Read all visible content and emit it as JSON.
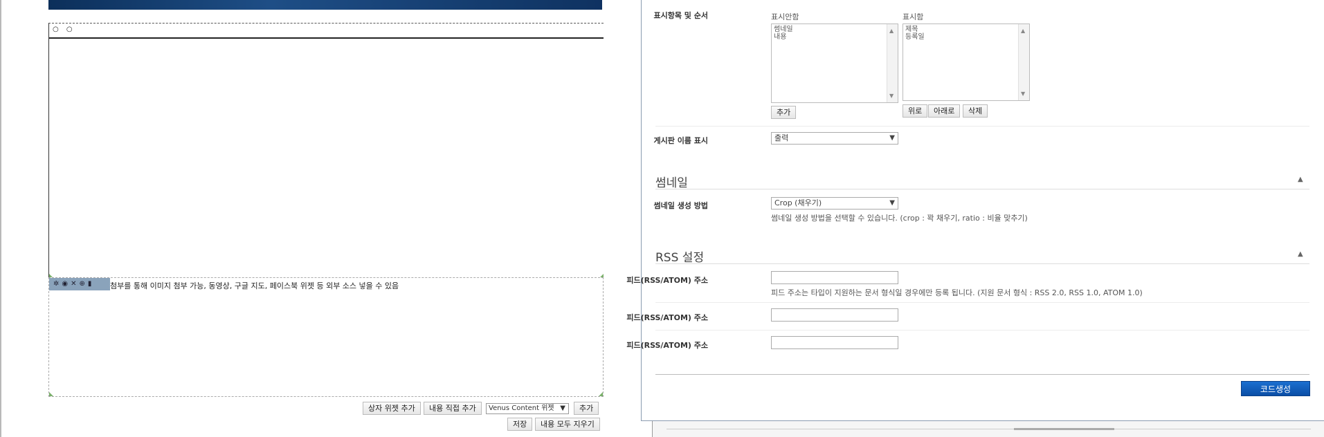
{
  "editor": {
    "widget_dots": "○ ○",
    "toolbar_icons": [
      "gear-icon",
      "eye-icon",
      "cross-icon",
      "plus-circle-icon",
      "trash-icon"
    ],
    "toolbar_glyphs": [
      "✲",
      "◉",
      "✕",
      "⊕",
      "▮"
    ],
    "content_text": "첨부를 통해 이미지 첨부 가능, 동영상, 구글 지도, 페이스북 위젯 등 외부 소스 넣을 수 있음",
    "btn_add_box_widget": "상자 위젯 추가",
    "btn_add_content": "내용 직접 추가",
    "widget_select_value": "Venus Content 위젯",
    "btn_add": "추가",
    "btn_save": "저장",
    "btn_clear_all": "내용 모두 지우기"
  },
  "dialog": {
    "display_items_label": "표시항목 및 순서",
    "hidden_caption": "표시안함",
    "hidden_items": [
      "썸네일",
      "내용"
    ],
    "btn_add_item": "추가",
    "shown_caption": "표시함",
    "shown_items": [
      "제목",
      "등록일"
    ],
    "btn_up": "위로",
    "btn_down": "아래로",
    "btn_delete": "삭제",
    "board_name_label": "게시판 이름 표시",
    "board_name_value": "출력",
    "thumbnail_section": "썸네일",
    "thumbnail_method_label": "썸네일 생성 방법",
    "thumbnail_method_value": "Crop (채우기)",
    "thumbnail_help": "썸네일 생성 방법을 선택할 수 있습니다. (crop : 꽉 채우기, ratio : 비율 맞추기)",
    "rss_section": "RSS 설정",
    "feed_label": "피드(RSS/ATOM) 주소",
    "feed_help": "피드 주소는 타입이 지원하는 문서 형식일 경우에만 등록 됩니다. (지원 문서 형식 : RSS 2.0, RSS 1.0, ATOM 1.0)",
    "btn_generate": "코드생성"
  },
  "colors": {
    "primary": "#0b5ac2",
    "frame_accent": "#7ab06a"
  }
}
